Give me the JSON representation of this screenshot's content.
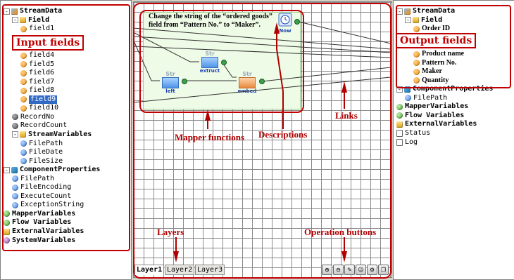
{
  "left_tree": [
    {
      "label": "StreamData",
      "icon": "stream",
      "bold": true,
      "indent": 0,
      "exp": "-"
    },
    {
      "label": "Field",
      "icon": "folder",
      "bold": true,
      "indent": 1,
      "exp": "-"
    },
    {
      "label": "field1",
      "icon": "orange",
      "indent": 2
    },
    {
      "label": "field4",
      "icon": "orange",
      "indent": 2
    },
    {
      "label": "field5",
      "icon": "orange",
      "indent": 2
    },
    {
      "label": "field6",
      "icon": "orange",
      "indent": 2
    },
    {
      "label": "field7",
      "icon": "orange",
      "indent": 2
    },
    {
      "label": "field8",
      "icon": "orange",
      "indent": 2
    },
    {
      "label": "field9",
      "icon": "orange",
      "indent": 2,
      "selected": true
    },
    {
      "label": "field10",
      "icon": "orange",
      "indent": 2
    },
    {
      "label": "RecordNo",
      "icon": "dark",
      "indent": 1
    },
    {
      "label": "RecordCount",
      "icon": "dark",
      "indent": 1
    },
    {
      "label": "StreamVariables",
      "icon": "folder",
      "bold": true,
      "indent": 1,
      "exp": "-"
    },
    {
      "label": "FilePath",
      "icon": "blue",
      "indent": 2
    },
    {
      "label": "FileDate",
      "icon": "blue",
      "indent": 2
    },
    {
      "label": "FileSize",
      "icon": "blue",
      "indent": 2
    },
    {
      "label": "ComponentProperties",
      "icon": "comp",
      "bold": true,
      "indent": 0,
      "exp": "-"
    },
    {
      "label": "FilePath",
      "icon": "blue",
      "indent": 1
    },
    {
      "label": "FileEncoding",
      "icon": "blue",
      "indent": 1
    },
    {
      "label": "ExecuteCount",
      "icon": "blue",
      "indent": 1
    },
    {
      "label": "ExceptionString",
      "icon": "blue",
      "indent": 1
    },
    {
      "label": "MapperVariables",
      "icon": "green",
      "bold": true,
      "indent": 0
    },
    {
      "label": "Flow Variables",
      "icon": "green",
      "bold": true,
      "indent": 0
    },
    {
      "label": "ExternalVariables",
      "icon": "folder",
      "bold": true,
      "indent": 0
    },
    {
      "label": "SystemVariables",
      "icon": "purple",
      "bold": true,
      "indent": 0
    }
  ],
  "right_tree": [
    {
      "label": "StreamData",
      "icon": "stream",
      "bold": true,
      "indent": 0,
      "exp": "-"
    },
    {
      "label": "Field",
      "icon": "folder",
      "bold": true,
      "indent": 1,
      "exp": "-"
    },
    {
      "label": "Order ID",
      "icon": "orange",
      "indent": 2,
      "serif": true
    },
    {
      "label": "Product name",
      "icon": "orange",
      "indent": 2,
      "serif": true
    },
    {
      "label": "Pattern No.",
      "icon": "orange",
      "indent": 2,
      "serif": true
    },
    {
      "label": "Maker",
      "icon": "orange",
      "indent": 2,
      "serif": true
    },
    {
      "label": "Quantity",
      "icon": "orange",
      "indent": 2,
      "serif": true
    },
    {
      "label": "ComponentProperties",
      "icon": "comp",
      "bold": true,
      "indent": 0,
      "exp": "-"
    },
    {
      "label": "FilePath",
      "icon": "blue",
      "indent": 1
    },
    {
      "label": "MapperVariables",
      "icon": "green",
      "bold": true,
      "indent": 0
    },
    {
      "label": "Flow Variables",
      "icon": "green",
      "bold": true,
      "indent": 0
    },
    {
      "label": "ExternalVariables",
      "icon": "folder",
      "bold": true,
      "indent": 0
    },
    {
      "label": "Status",
      "icon": "doc",
      "indent": 0
    },
    {
      "label": "Log",
      "icon": "doc",
      "indent": 0
    }
  ],
  "annotations": {
    "input_fields": "Input fields",
    "output_fields": "Output fields",
    "description_text": "Change the string of the “ordered goods” field from “Pattern No.” to “Maker”.",
    "mapper_functions": "Mapper functions",
    "descriptions": "Descriptions",
    "links": "Links",
    "layers": "Layers",
    "operation_buttons": "Operation buttons"
  },
  "functions": {
    "extruct": "extruct",
    "left": "left",
    "embed": "embed",
    "str": "Str",
    "now": "Now"
  },
  "layer_tabs": [
    "Layer1",
    "Layer2",
    "Layer3"
  ],
  "operation_buttons": [
    "zoom-in",
    "zoom-out",
    "edit",
    "comment",
    "settings",
    "copy"
  ]
}
